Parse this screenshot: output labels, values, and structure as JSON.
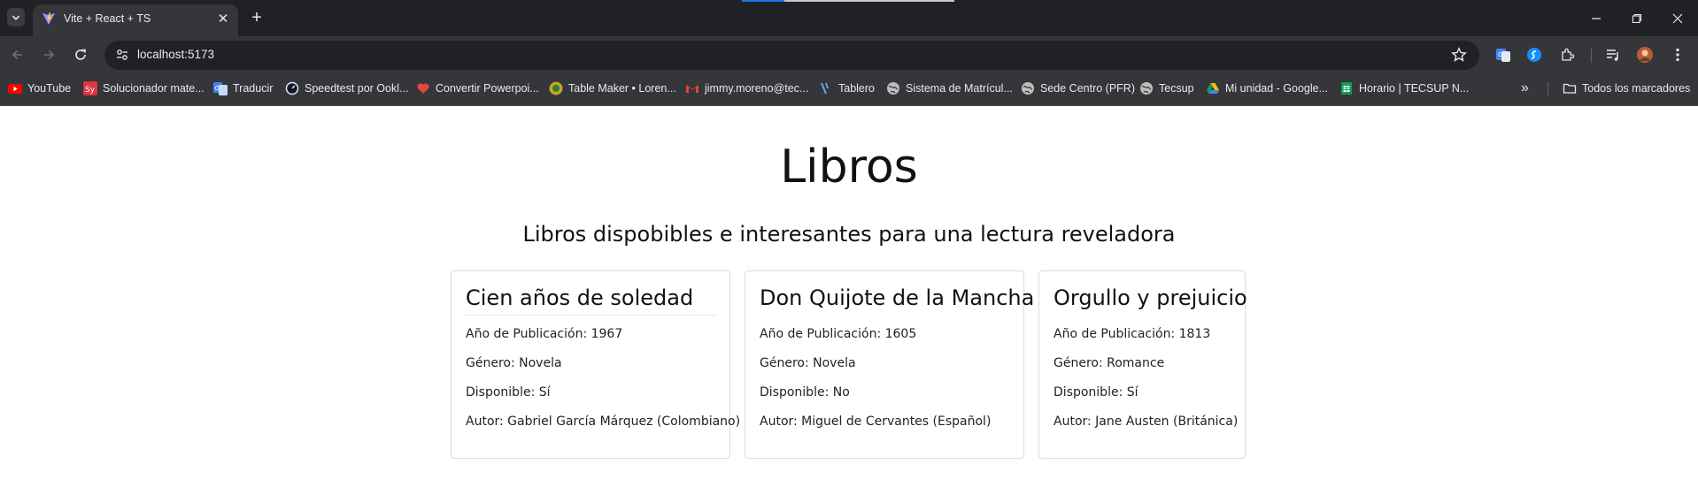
{
  "browser": {
    "tab": {
      "title": "Vite + React + TS"
    },
    "address_bar": {
      "url": "localhost:5173"
    }
  },
  "bookmarks": [
    {
      "label": "YouTube",
      "icon": "youtube-icon"
    },
    {
      "label": "Solucionador mate...",
      "icon": "symbolab-icon"
    },
    {
      "label": "Traducir",
      "icon": "translate-icon"
    },
    {
      "label": "Speedtest por Ookl...",
      "icon": "speedtest-icon"
    },
    {
      "label": "Convertir Powerpoi...",
      "icon": "heart-icon"
    },
    {
      "label": "Table Maker • Loren...",
      "icon": "table-maker-icon"
    },
    {
      "label": "jimmy.moreno@tec...",
      "icon": "gmail-icon"
    },
    {
      "label": "Tablero",
      "icon": "tablero-icon"
    },
    {
      "label": "Sistema de Matrícul...",
      "icon": "globe-icon"
    },
    {
      "label": "Sede Centro (PFR)",
      "icon": "globe-icon"
    },
    {
      "label": "Tecsup",
      "icon": "globe-icon"
    },
    {
      "label": "Mi unidad - Google...",
      "icon": "drive-icon"
    },
    {
      "label": "Horario | TECSUP N...",
      "icon": "sheets-icon"
    }
  ],
  "bookmarks_overflow": "»",
  "all_bookmarks_label": "Todos los marcadores",
  "page": {
    "title": "Libros",
    "subtitle": "Libros dispobibles e interesantes para una lectura reveladora",
    "books": [
      {
        "title": "Cien años de soledad",
        "year": "Año de Publicación: 1967",
        "genre": "Género: Novela",
        "available": "Disponible: Sí",
        "author": "Autor: Gabriel García Márquez (Colombiano)"
      },
      {
        "title": "Don Quijote de la Mancha",
        "year": "Año de Publicación: 1605",
        "genre": "Género: Novela",
        "available": "Disponible: No",
        "author": "Autor: Miguel de Cervantes (Español)"
      },
      {
        "title": "Orgullo y prejuicio",
        "year": "Año de Publicación: 1813",
        "genre": "Género: Romance",
        "available": "Disponible: Sí",
        "author": "Autor: Jane Austen (Británica)"
      }
    ]
  },
  "colors": {
    "chrome_dark": "#202124",
    "chrome_toolbar": "#35363a",
    "text_light": "#e8eaed"
  }
}
